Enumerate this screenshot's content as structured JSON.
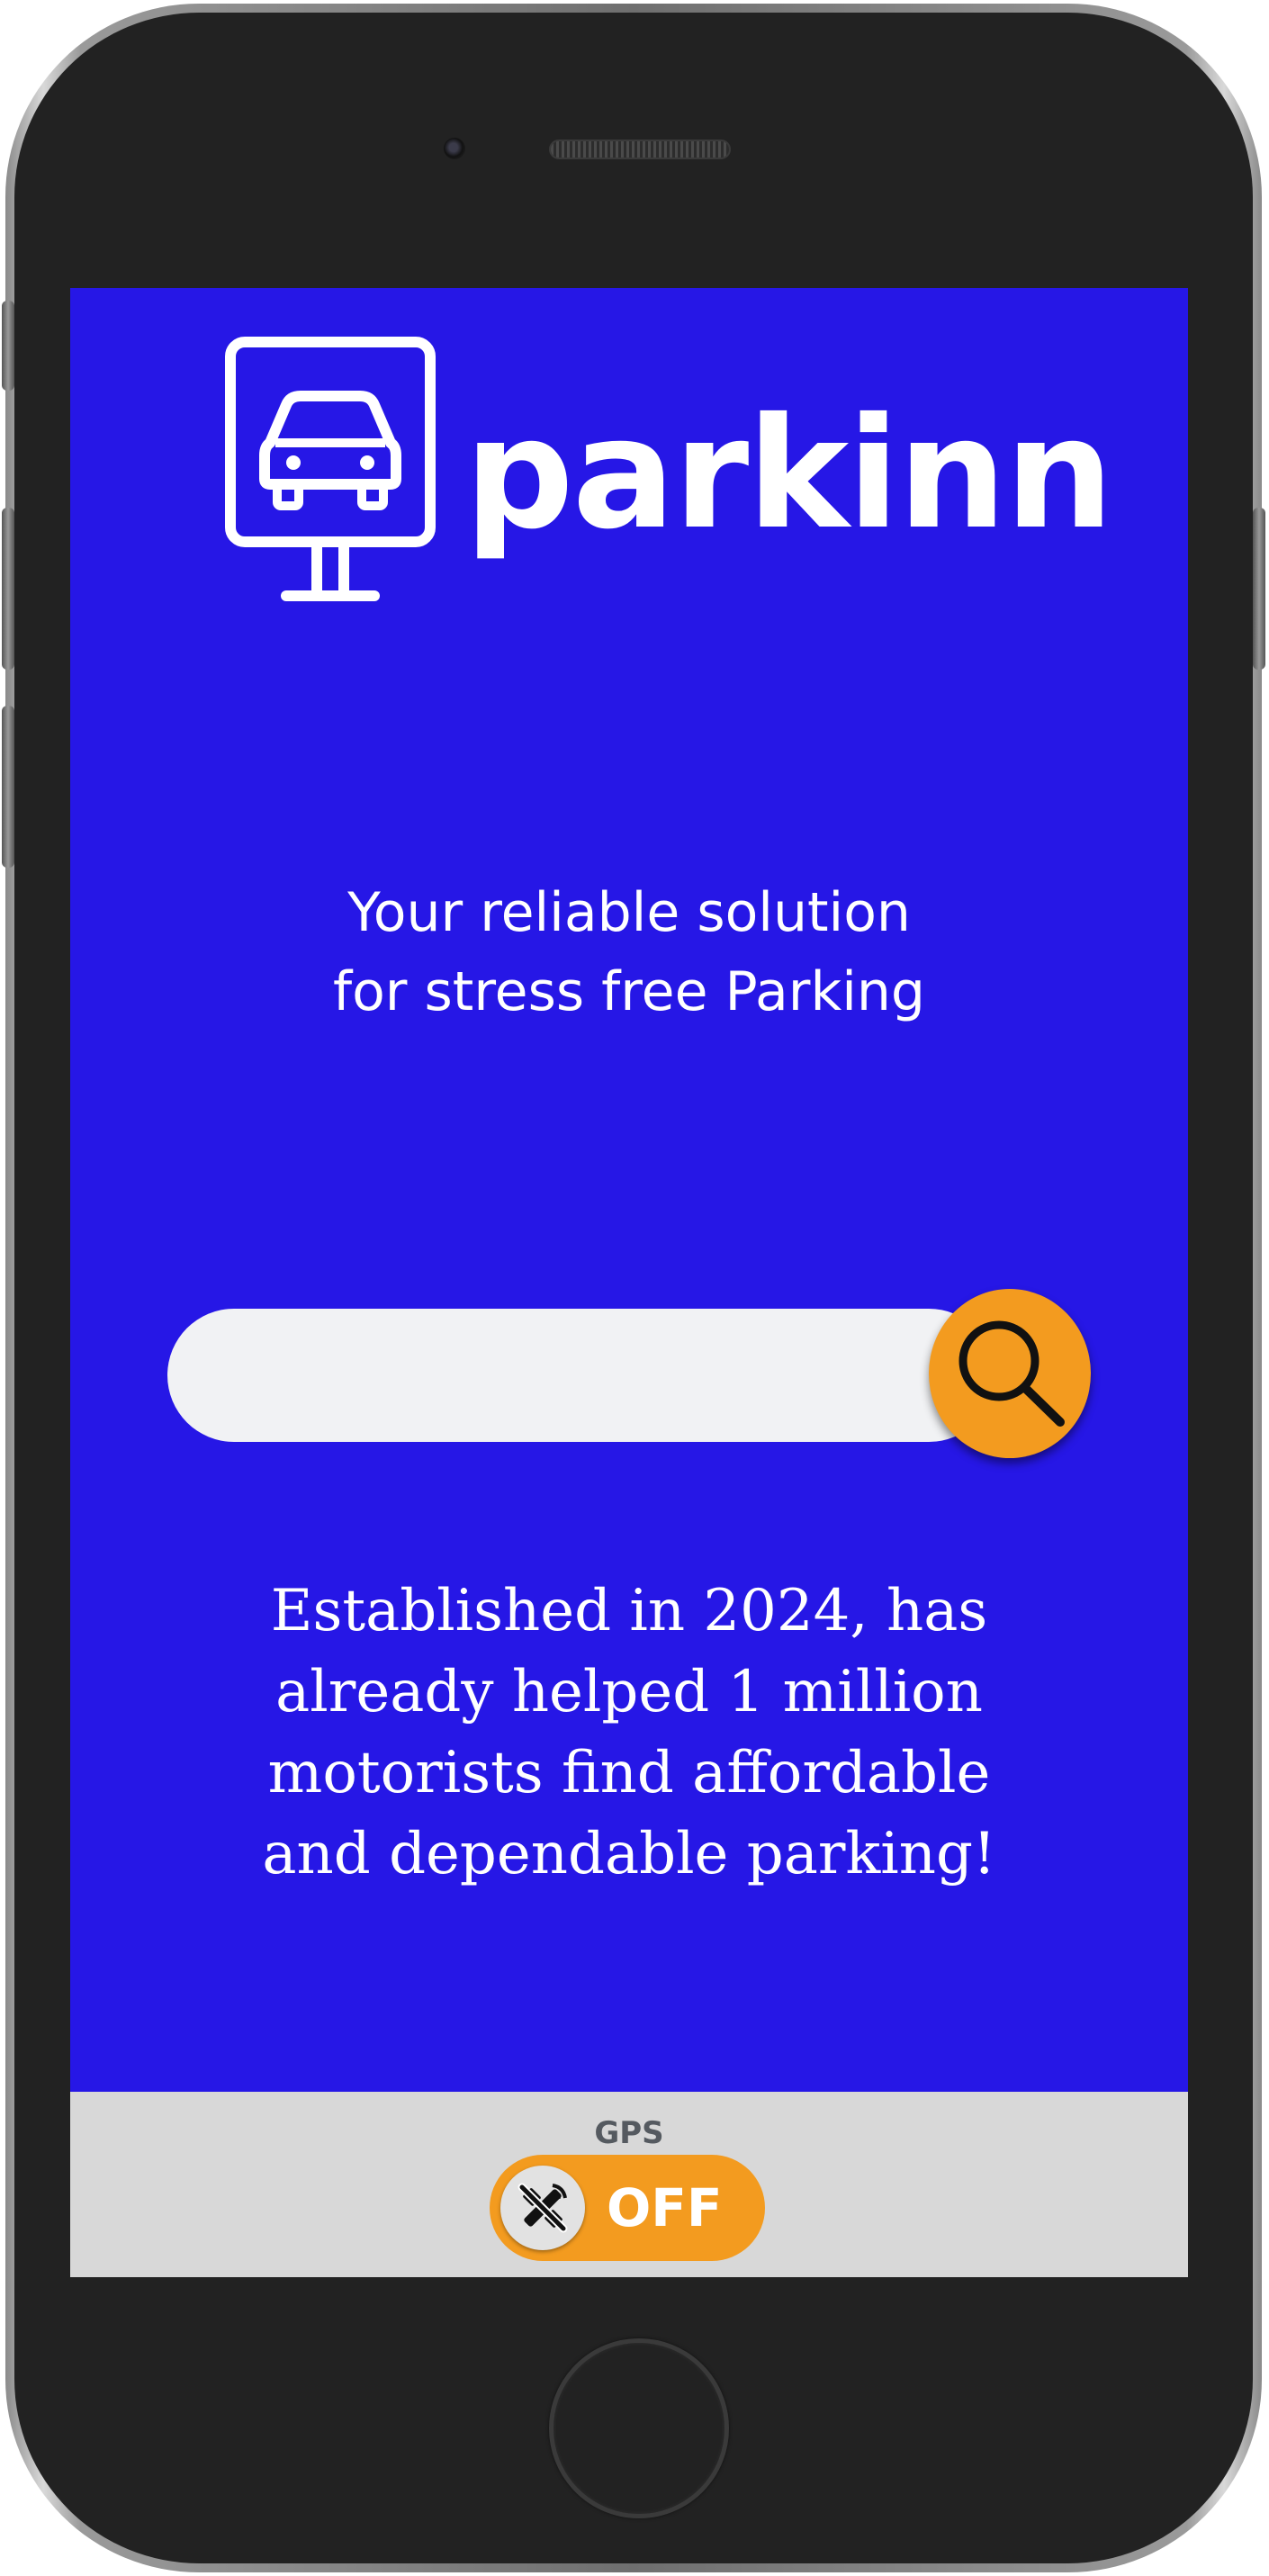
{
  "brand": {
    "name": "parkinn",
    "logo_icon": "car-signboard-icon",
    "color": "#ffffff"
  },
  "tagline": {
    "line1": "Your reliable solution",
    "line2": "for stress free Parking"
  },
  "search": {
    "value": "",
    "placeholder": "",
    "button_icon": "search-icon"
  },
  "about": {
    "line1": "Established in 2024, has",
    "line2": "already helped 1 million",
    "line3": "motorists find affordable",
    "line4": "and dependable parking!"
  },
  "gps": {
    "label": "GPS",
    "state": "OFF",
    "icon": "satellite-off-icon"
  },
  "colors": {
    "screen_background": "#2617e6",
    "accent": "#f39b1f",
    "footer_background": "#d8d8d8"
  }
}
